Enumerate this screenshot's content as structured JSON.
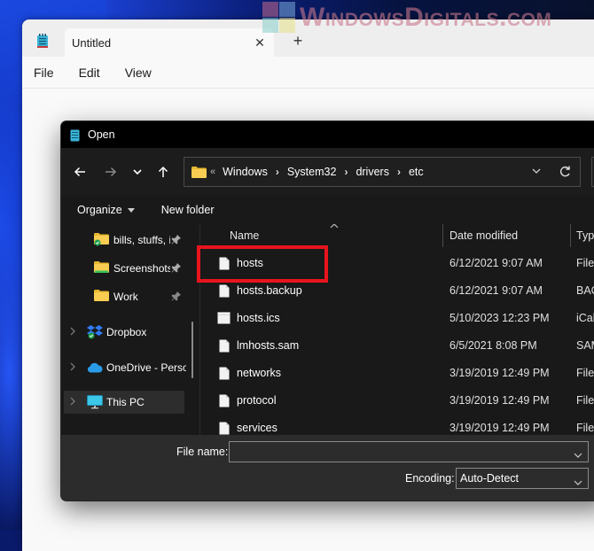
{
  "watermark": {
    "text": "WindowsDigitals.com"
  },
  "notepad": {
    "tab_title": "Untitled",
    "menu": [
      "File",
      "Edit",
      "View"
    ]
  },
  "dialog": {
    "title": "Open",
    "address": {
      "overflow_marker": "«",
      "breadcrumbs": [
        "Windows",
        "System32",
        "drivers",
        "etc"
      ]
    },
    "commands": {
      "organize": "Organize",
      "new_folder": "New folder"
    },
    "nav_pane": {
      "pinned": [
        {
          "label": "bills, stuffs, i",
          "icon": "folder-synced-icon"
        },
        {
          "label": "Screenshots",
          "icon": "folder-icon"
        },
        {
          "label": "Work",
          "icon": "folder-icon"
        }
      ],
      "locations": [
        {
          "label": "Dropbox",
          "icon": "dropbox-icon"
        },
        {
          "label": "OneDrive - Perso",
          "icon": "onedrive-icon"
        },
        {
          "label": "This PC",
          "icon": "this-pc-icon",
          "selected": true
        }
      ]
    },
    "columns": {
      "name": "Name",
      "date": "Date modified",
      "type": "Typ"
    },
    "files": [
      {
        "name": "hosts",
        "date": "6/12/2021 9:07 AM",
        "type": "File",
        "highlighted": true
      },
      {
        "name": "hosts.backup",
        "date": "6/12/2021 9:07 AM",
        "type": "BAC"
      },
      {
        "name": "hosts.ics",
        "date": "5/10/2023 12:23 PM",
        "type": "iCal"
      },
      {
        "name": "lmhosts.sam",
        "date": "6/5/2021 8:08 PM",
        "type": "SAM"
      },
      {
        "name": "networks",
        "date": "3/19/2019 12:49 PM",
        "type": "File"
      },
      {
        "name": "protocol",
        "date": "3/19/2019 12:49 PM",
        "type": "File"
      },
      {
        "name": "services",
        "date": "3/19/2019 12:49 PM",
        "type": "File"
      }
    ],
    "footer": {
      "file_name_label": "File name:",
      "file_name_value": "",
      "encoding_label": "Encoding:",
      "encoding_value": "Auto-Detect"
    }
  },
  "colors": {
    "highlight": "#e8141c",
    "folder": "#f4c542",
    "dialog_bg": "#202020"
  }
}
